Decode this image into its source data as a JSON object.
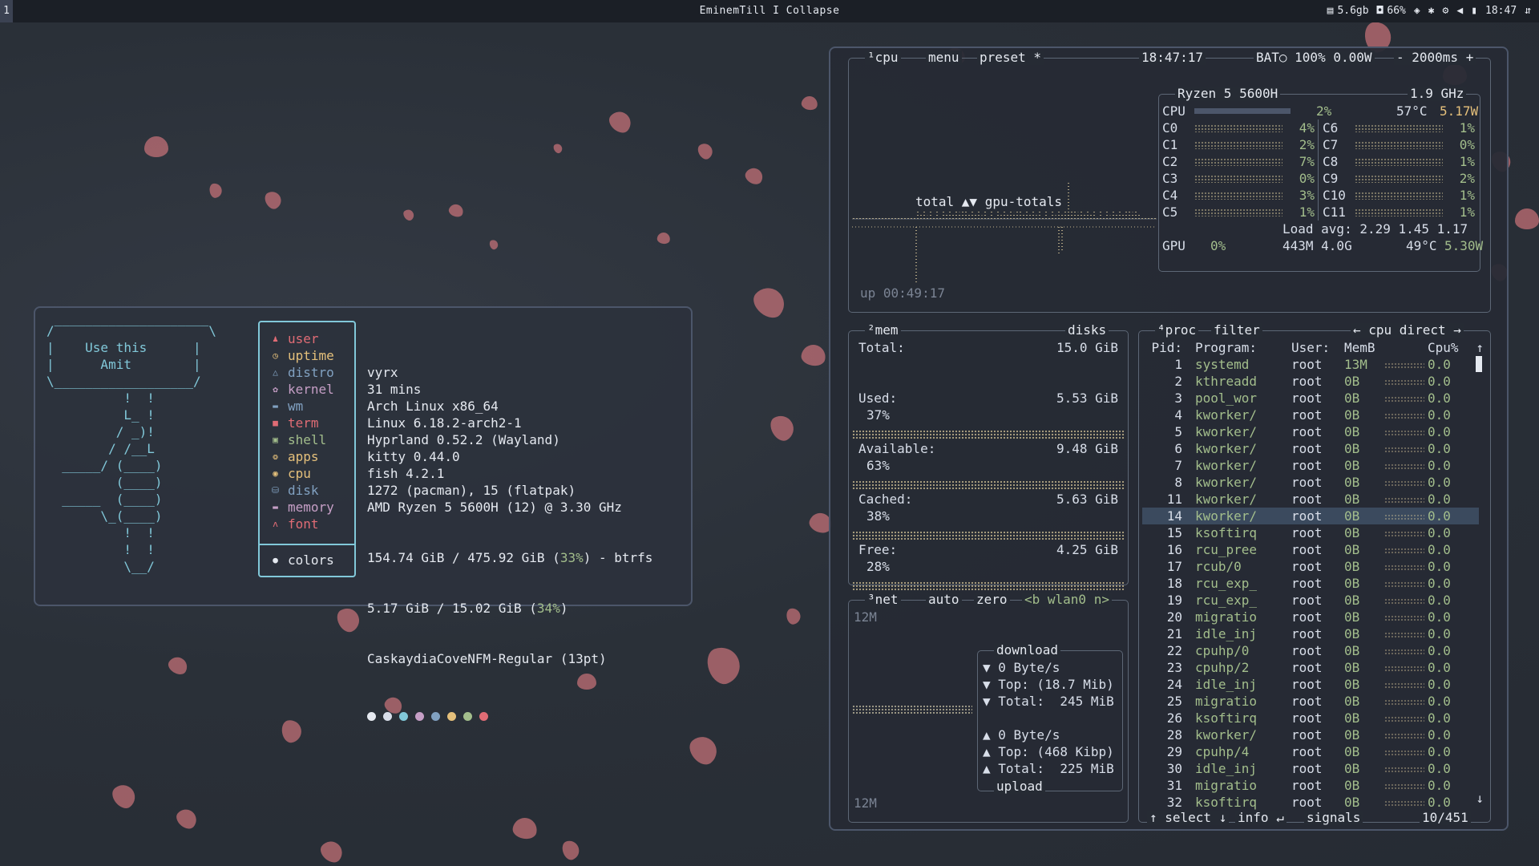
{
  "topbar": {
    "workspace": "1",
    "title": "EminemTill I Collapse",
    "items": [
      "5.6gb",
      "66%",
      "18:47"
    ]
  },
  "fetch": {
    "ascii": "/‾‾‾‾‾‾‾‾‾‾‾‾‾‾‾‾‾‾‾‾\\\n|    Use this      |\n|      Amit        |\n\\__________________/\n          !  !\n          L_ !\n         / _)!\n        / /__L\n  _____/ (____)\n         (____)\n  _____  (____)\n       \\_(____)\n          !  !\n          !  !\n          \\__/",
    "labels": [
      {
        "icon": "user-icon",
        "glyph": "♟",
        "text": "user",
        "color": "#e06c75"
      },
      {
        "icon": "clock-icon",
        "glyph": "◷",
        "text": "uptime",
        "color": "#e5c07b"
      },
      {
        "icon": "distro-icon",
        "glyph": "△",
        "text": "distro",
        "color": "#81a1c1"
      },
      {
        "icon": "gear-icon",
        "glyph": "✿",
        "text": "kernel",
        "color": "#c69fc6"
      },
      {
        "icon": "window-icon",
        "glyph": "▬",
        "text": "wm",
        "color": "#81a1c1"
      },
      {
        "icon": "terminal-icon",
        "glyph": "■",
        "text": "term",
        "color": "#e06c75"
      },
      {
        "icon": "shell-icon",
        "glyph": "▣",
        "text": "shell",
        "color": "#a3be8c"
      },
      {
        "icon": "package-icon",
        "glyph": "❂",
        "text": "apps",
        "color": "#e5c07b"
      },
      {
        "icon": "cpu-icon",
        "glyph": "◉",
        "text": "cpu",
        "color": "#e5c07b"
      },
      {
        "icon": "disk-icon",
        "glyph": "⛁",
        "text": "disk",
        "color": "#81a1c1"
      },
      {
        "icon": "memory-icon",
        "glyph": "▬",
        "text": "memory",
        "color": "#c69fc6"
      },
      {
        "icon": "font-icon",
        "glyph": "ʌ",
        "text": "font",
        "color": "#e06c75"
      }
    ],
    "colors_label": "colors",
    "values": [
      "vyrx",
      "31 mins",
      "Arch Linux x86_64",
      "Linux 6.18.2-arch2-1",
      "Hyprland 0.52.2 (Wayland)",
      "kitty 0.44.0",
      "fish 4.2.1",
      "1272 (pacman), 15 (flatpak)",
      "AMD Ryzen 5 5600H (12) @ 3.30 GHz"
    ],
    "disk": {
      "pre": "154.74 GiB / 475.92 GiB (",
      "pct": "33%",
      "post": ") - btrfs"
    },
    "mem": {
      "pre": "5.17 GiB / 15.02 GiB (",
      "pct": "34%",
      "post": ")"
    },
    "font": "CaskaydiaCoveNFM-Regular (13pt)",
    "palette": [
      "#e5e9f0",
      "#d8dee9",
      "#81c8d9",
      "#c69fc6",
      "#81a1c1",
      "#e5c07b",
      "#a3be8c",
      "#e06c75"
    ]
  },
  "btop": {
    "cpu": {
      "tab": "¹cpu",
      "menu": "menu",
      "preset": "preset *",
      "time": "18:47:17",
      "bat": "BAT○ 100% 0.00W",
      "rate": "- 2000ms +",
      "model": "Ryzen 5 5600H",
      "freq": "1.9 GHz",
      "cpu_total": "2%",
      "temp": "57°C",
      "watts": "5.17W",
      "cores_left": [
        [
          "C0",
          "4%"
        ],
        [
          "C1",
          "2%"
        ],
        [
          "C2",
          "7%"
        ],
        [
          "C3",
          "0%"
        ],
        [
          "C4",
          "3%"
        ],
        [
          "C5",
          "1%"
        ]
      ],
      "cores_right": [
        [
          "C6",
          "1%"
        ],
        [
          "C7",
          "0%"
        ],
        [
          "C8",
          "1%"
        ],
        [
          "C9",
          "2%"
        ],
        [
          "C10",
          "1%"
        ],
        [
          "C11",
          "1%"
        ]
      ],
      "load": "Load avg: 2.29 1.45 1.17",
      "gpu": "GPU",
      "gpu_pct": "0%",
      "gpu_mem": "443M 4.0G",
      "gpu_temp": "49°C",
      "gpu_w": "5.30W",
      "graph_label": "total ▲▼ gpu-totals",
      "uptime": "up 00:49:17"
    },
    "mem": {
      "tab": "²mem",
      "disks": "disks",
      "rows": [
        {
          "label": "Total:",
          "value": "15.0 GiB",
          "pct": ""
        },
        {
          "label": "Used:",
          "value": "5.53 GiB",
          "pct": "37%"
        },
        {
          "label": "Available:",
          "value": "9.48 GiB",
          "pct": "63%"
        },
        {
          "label": "Cached:",
          "value": "5.63 GiB",
          "pct": "38%"
        },
        {
          "label": "Free:",
          "value": "4.25 GiB",
          "pct": "28%"
        }
      ]
    },
    "net": {
      "tab": "³net",
      "auto": "auto",
      "zero": "zero",
      "iface": "<b wlan0 n>",
      "scale_top": "12M",
      "scale_bot": "12M",
      "download": "download",
      "dl": [
        "▼ 0 Byte/s",
        "▼ Top: (18.7 Mib)",
        "▼ Total:  245 MiB"
      ],
      "ul": [
        "▲ 0 Byte/s",
        "▲ Top: (468 Kibp)",
        "▲ Total:  225 MiB"
      ],
      "upload": "upload"
    },
    "proc": {
      "tab": "⁴proc",
      "filter": "filter",
      "sort": "← cpu direct →",
      "headers": [
        "Pid:",
        "Program:",
        "User:",
        "MemB",
        "Cpu%"
      ],
      "rows": [
        [
          "1",
          "systemd",
          "root",
          "13M",
          "0.0"
        ],
        [
          "2",
          "kthreadd",
          "root",
          "0B",
          "0.0"
        ],
        [
          "3",
          "pool_wor",
          "root",
          "0B",
          "0.0"
        ],
        [
          "4",
          "kworker/",
          "root",
          "0B",
          "0.0"
        ],
        [
          "5",
          "kworker/",
          "root",
          "0B",
          "0.0"
        ],
        [
          "6",
          "kworker/",
          "root",
          "0B",
          "0.0"
        ],
        [
          "7",
          "kworker/",
          "root",
          "0B",
          "0.0"
        ],
        [
          "8",
          "kworker/",
          "root",
          "0B",
          "0.0"
        ],
        [
          "11",
          "kworker/",
          "root",
          "0B",
          "0.0"
        ],
        [
          "14",
          "kworker/",
          "root",
          "0B",
          "0.0"
        ],
        [
          "15",
          "ksoftirq",
          "root",
          "0B",
          "0.0"
        ],
        [
          "16",
          "rcu_pree",
          "root",
          "0B",
          "0.0"
        ],
        [
          "17",
          "rcub/0",
          "root",
          "0B",
          "0.0"
        ],
        [
          "18",
          "rcu_exp_",
          "root",
          "0B",
          "0.0"
        ],
        [
          "19",
          "rcu_exp_",
          "root",
          "0B",
          "0.0"
        ],
        [
          "20",
          "migratio",
          "root",
          "0B",
          "0.0"
        ],
        [
          "21",
          "idle_inj",
          "root",
          "0B",
          "0.0"
        ],
        [
          "22",
          "cpuhp/0",
          "root",
          "0B",
          "0.0"
        ],
        [
          "23",
          "cpuhp/2",
          "root",
          "0B",
          "0.0"
        ],
        [
          "24",
          "idle_inj",
          "root",
          "0B",
          "0.0"
        ],
        [
          "25",
          "migratio",
          "root",
          "0B",
          "0.0"
        ],
        [
          "26",
          "ksoftirq",
          "root",
          "0B",
          "0.0"
        ],
        [
          "28",
          "kworker/",
          "root",
          "0B",
          "0.0"
        ],
        [
          "29",
          "cpuhp/4",
          "root",
          "0B",
          "0.0"
        ],
        [
          "30",
          "idle_inj",
          "root",
          "0B",
          "0.0"
        ],
        [
          "31",
          "migratio",
          "root",
          "0B",
          "0.0"
        ],
        [
          "32",
          "ksoftirq",
          "root",
          "0B",
          "0.0"
        ]
      ],
      "selected_pid": "14",
      "footer": {
        "select": "↑ select ↓",
        "info": "info ↵",
        "signals": "signals",
        "count": "10/451"
      }
    }
  },
  "colors": {
    "accent": "#81c8d9",
    "label_fg": "#e06c75",
    "green": "#a3be8c",
    "cyan": "#81c8d9",
    "yellow": "#e5c07b"
  }
}
